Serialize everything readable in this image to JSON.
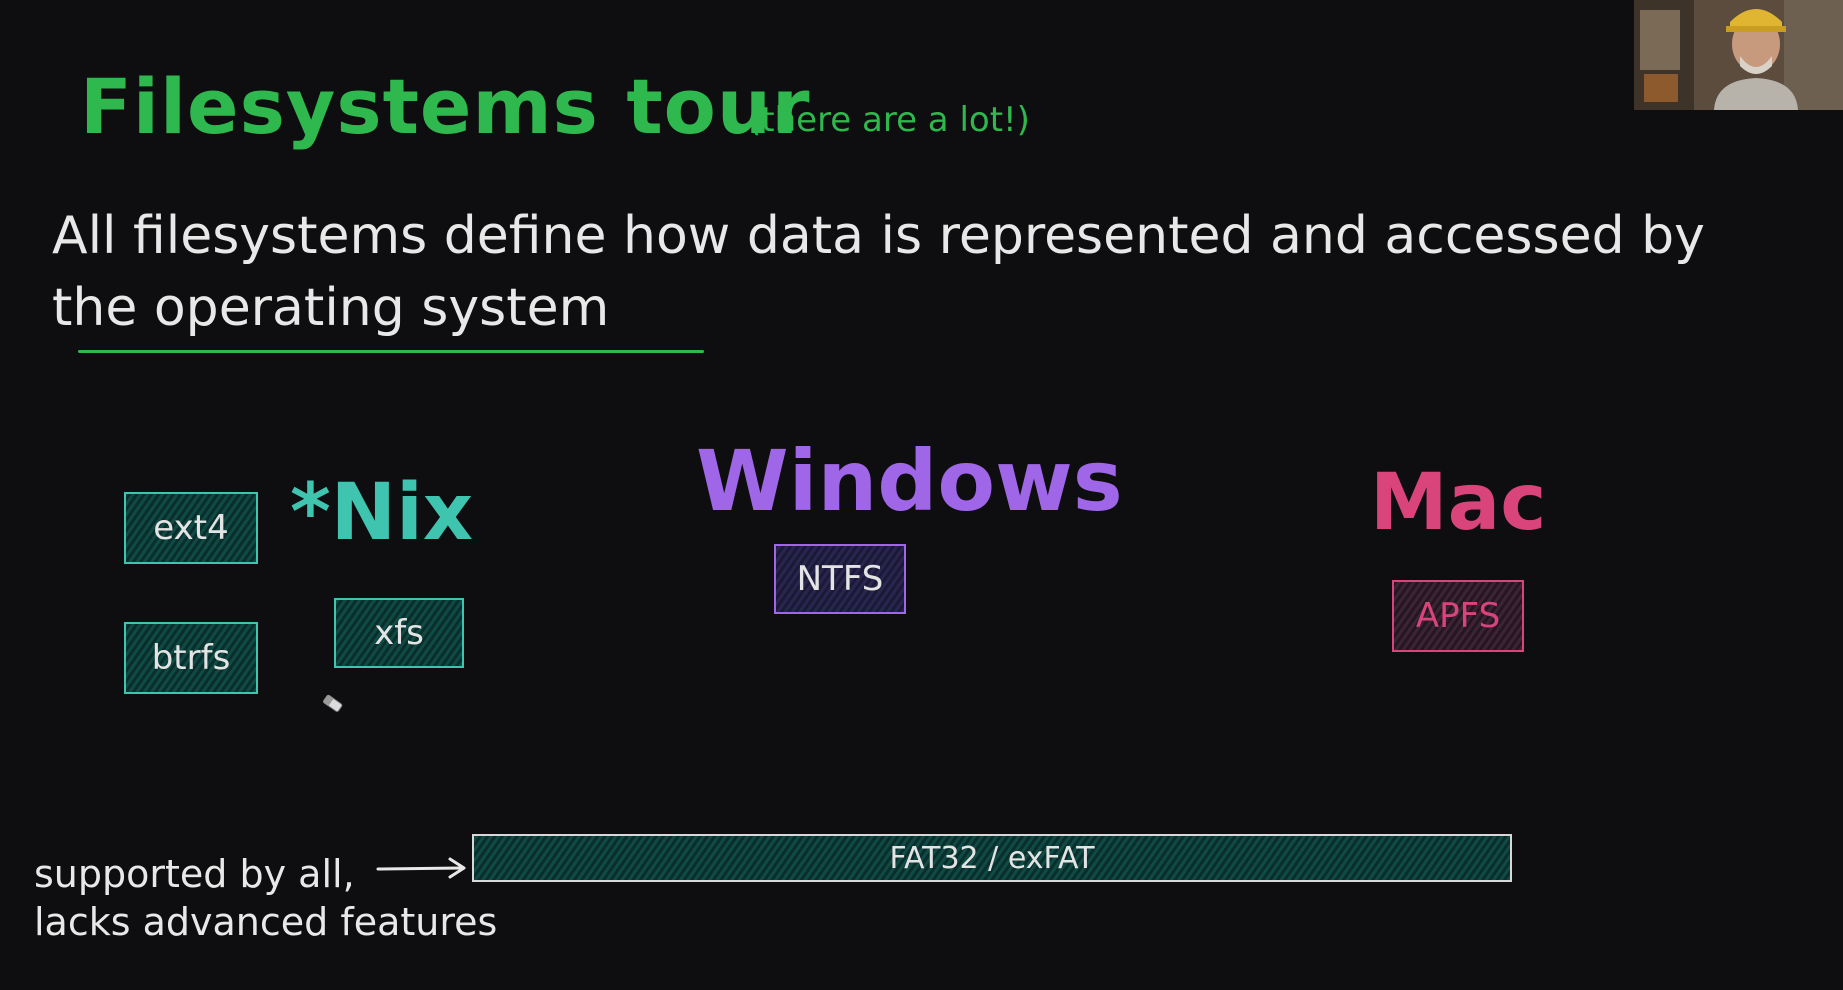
{
  "title": "Filesystems tour",
  "subtitle": "(there are a lot!)",
  "headline": "All filesystems define how data is represented and accessed by the operating system",
  "os": {
    "nix": "*Nix",
    "windows": "Windows",
    "mac": "Mac"
  },
  "filesystems": {
    "ext4": "ext4",
    "btrfs": "btrfs",
    "xfs": "xfs",
    "ntfs": "NTFS",
    "apfs": "APFS",
    "fat": "FAT32 / exFAT"
  },
  "note": {
    "line1": "supported by all,",
    "line2": "lacks advanced features"
  },
  "colors": {
    "background": "#0e0e10",
    "title_green": "#2fb84d",
    "nix_teal": "#3fc4b0",
    "windows_purple": "#a066e8",
    "mac_pink": "#d9457a",
    "box_fill_teal": "#0f4a44",
    "box_fill_purple": "#2a2550",
    "box_fill_pink": "#3d2434"
  }
}
